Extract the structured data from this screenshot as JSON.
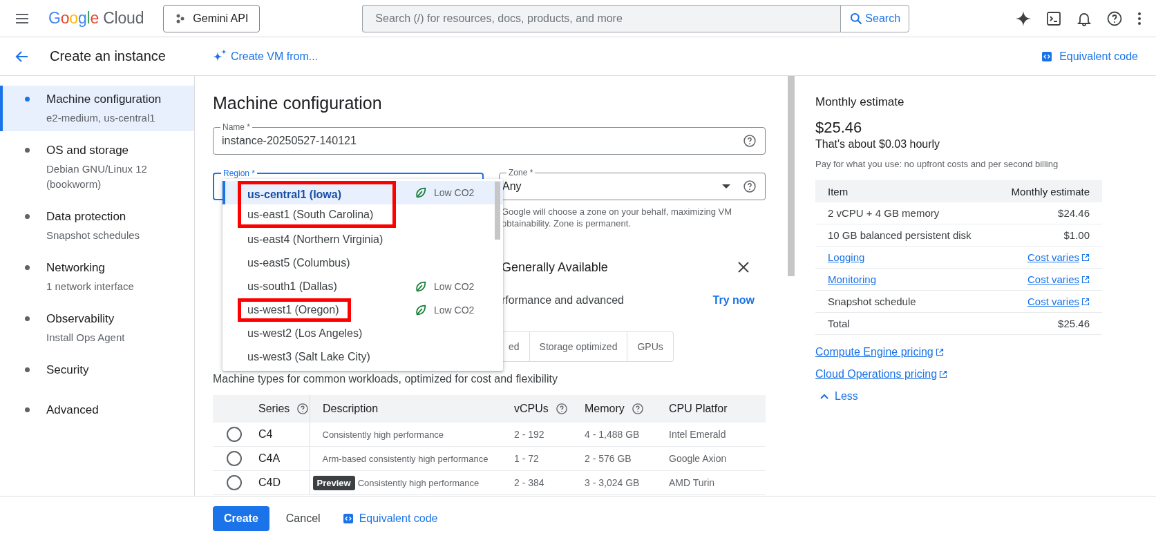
{
  "top_bar": {
    "logo": {
      "brand": "Google",
      "product": "Cloud"
    },
    "project_button": "Gemini API",
    "search": {
      "placeholder": "Search (/) for resources, docs, products, and more",
      "button": "Search"
    }
  },
  "page_header": {
    "title": "Create an instance",
    "create_from": "Create VM from...",
    "equivalent_code": "Equivalent code"
  },
  "sidebar": {
    "items": [
      {
        "title": "Machine configuration",
        "subtitle": "e2-medium, us-central1",
        "selected": true
      },
      {
        "title": "OS and storage",
        "subtitle": "Debian GNU/Linux 12 (bookworm)",
        "selected": false
      },
      {
        "title": "Data protection",
        "subtitle": "Snapshot schedules",
        "selected": false
      },
      {
        "title": "Networking",
        "subtitle": "1 network interface",
        "selected": false
      },
      {
        "title": "Observability",
        "subtitle": "Install Ops Agent",
        "selected": false
      },
      {
        "title": "Security",
        "selected": false
      },
      {
        "title": "Advanced",
        "selected": false
      }
    ]
  },
  "form": {
    "title": "Machine configuration",
    "name_field": {
      "label": "Name *",
      "value": "instance-20250527-140121"
    },
    "region_field": {
      "label": "Region *"
    },
    "zone_field": {
      "label": "Zone *",
      "value": "Any",
      "helper": "Google will choose a zone on your behalf, maximizing VM obtainability. Zone is permanent."
    },
    "region_options": [
      {
        "label": "us-central1 (Iowa)",
        "tag": "Low CO2",
        "selected": true,
        "highlighted": true
      },
      {
        "label": "us-east1 (South Carolina)",
        "selected": false,
        "highlighted": true
      },
      {
        "label": "us-east4 (Northern Virginia)",
        "selected": false,
        "highlighted": false
      },
      {
        "label": "us-east5 (Columbus)",
        "selected": false,
        "highlighted": false
      },
      {
        "label": "us-south1 (Dallas)",
        "tag": "Low CO2",
        "selected": false,
        "highlighted": false
      },
      {
        "label": "us-west1 (Oregon)",
        "tag": "Low CO2",
        "selected": false,
        "highlighted": true
      },
      {
        "label": "us-west2 (Los Angeles)",
        "selected": false,
        "highlighted": false
      },
      {
        "label": "us-west3 (Salt Lake City)",
        "selected": false,
        "highlighted": false
      }
    ],
    "banner": {
      "title": "Generally Available",
      "text": "rformance and advanced",
      "action": "Try now"
    },
    "tabs": [
      {
        "label": "ed",
        "selected": false
      },
      {
        "label": "Storage optimized",
        "selected": false
      },
      {
        "label": "GPUs",
        "selected": false
      }
    ],
    "machine_types_text": "Machine types for common workloads, optimized for cost and flexibility",
    "table": {
      "columns": [
        "Series",
        "Description",
        "vCPUs",
        "Memory",
        "CPU Platfor"
      ],
      "rows": [
        {
          "series": "C4",
          "description": "Consistently high performance",
          "vcpus": "2 - 192",
          "memory": "4 - 1,488 GB",
          "cpu_platform": "Intel Emerald",
          "selected": false
        },
        {
          "series": "C4A",
          "description": "Arm-based consistently high performance",
          "vcpus": "1 - 72",
          "memory": "2 - 576 GB",
          "cpu_platform": "Google Axion",
          "selected": false
        },
        {
          "series": "C4D",
          "badge": "Preview",
          "description": "Consistently high performance",
          "vcpus": "2 - 384",
          "memory": "3 - 3,024 GB",
          "cpu_platform": "AMD Turin",
          "selected": false
        }
      ]
    }
  },
  "estimate": {
    "title": "Monthly estimate",
    "total": "$25.46",
    "hourly": "That's about $0.03 hourly",
    "note": "Pay for what you use: no upfront costs and per second billing",
    "columns": [
      "Item",
      "Monthly estimate"
    ],
    "rows": [
      {
        "item": "2 vCPU + 4 GB memory",
        "item_link": false,
        "cost": "$24.46",
        "cost_link": false
      },
      {
        "item": "10 GB balanced persistent disk",
        "item_link": false,
        "cost": "$1.00",
        "cost_link": false
      },
      {
        "item": "Logging",
        "item_link": true,
        "cost": "Cost varies",
        "cost_link": true
      },
      {
        "item": "Monitoring",
        "item_link": true,
        "cost": "Cost varies",
        "cost_link": true
      },
      {
        "item": "Snapshot schedule",
        "item_link": false,
        "cost": "Cost varies",
        "cost_link": true
      },
      {
        "item": "Total",
        "item_link": false,
        "cost": "$25.46",
        "cost_link": false
      }
    ],
    "links": [
      "Compute Engine pricing",
      "Cloud Operations pricing"
    ],
    "less": "Less"
  },
  "footer": {
    "create": "Create",
    "cancel": "Cancel",
    "equivalent_code": "Equivalent code"
  }
}
